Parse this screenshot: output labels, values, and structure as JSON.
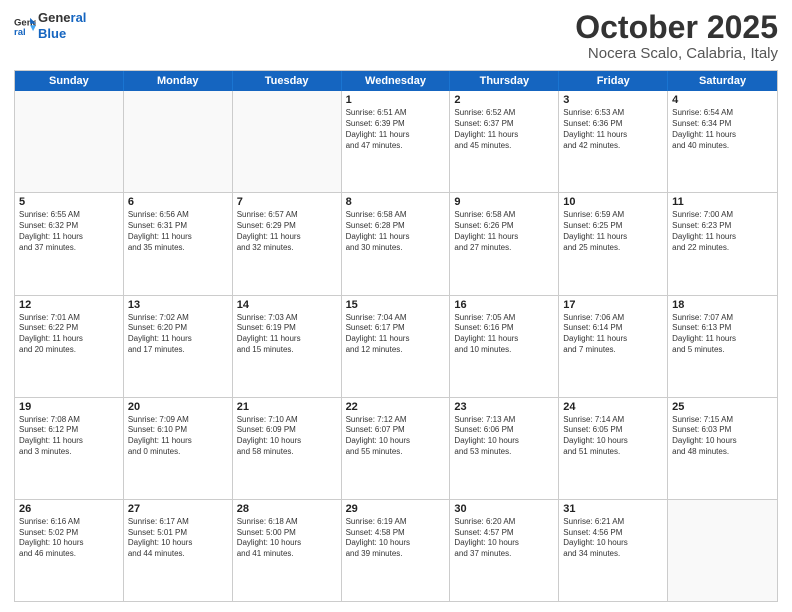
{
  "header": {
    "logo_line1": "General",
    "logo_line2": "Blue",
    "month": "October 2025",
    "location": "Nocera Scalo, Calabria, Italy"
  },
  "weekdays": [
    "Sunday",
    "Monday",
    "Tuesday",
    "Wednesday",
    "Thursday",
    "Friday",
    "Saturday"
  ],
  "weeks": [
    [
      {
        "day": "",
        "text": ""
      },
      {
        "day": "",
        "text": ""
      },
      {
        "day": "",
        "text": ""
      },
      {
        "day": "1",
        "text": "Sunrise: 6:51 AM\nSunset: 6:39 PM\nDaylight: 11 hours\nand 47 minutes."
      },
      {
        "day": "2",
        "text": "Sunrise: 6:52 AM\nSunset: 6:37 PM\nDaylight: 11 hours\nand 45 minutes."
      },
      {
        "day": "3",
        "text": "Sunrise: 6:53 AM\nSunset: 6:36 PM\nDaylight: 11 hours\nand 42 minutes."
      },
      {
        "day": "4",
        "text": "Sunrise: 6:54 AM\nSunset: 6:34 PM\nDaylight: 11 hours\nand 40 minutes."
      }
    ],
    [
      {
        "day": "5",
        "text": "Sunrise: 6:55 AM\nSunset: 6:32 PM\nDaylight: 11 hours\nand 37 minutes."
      },
      {
        "day": "6",
        "text": "Sunrise: 6:56 AM\nSunset: 6:31 PM\nDaylight: 11 hours\nand 35 minutes."
      },
      {
        "day": "7",
        "text": "Sunrise: 6:57 AM\nSunset: 6:29 PM\nDaylight: 11 hours\nand 32 minutes."
      },
      {
        "day": "8",
        "text": "Sunrise: 6:58 AM\nSunset: 6:28 PM\nDaylight: 11 hours\nand 30 minutes."
      },
      {
        "day": "9",
        "text": "Sunrise: 6:58 AM\nSunset: 6:26 PM\nDaylight: 11 hours\nand 27 minutes."
      },
      {
        "day": "10",
        "text": "Sunrise: 6:59 AM\nSunset: 6:25 PM\nDaylight: 11 hours\nand 25 minutes."
      },
      {
        "day": "11",
        "text": "Sunrise: 7:00 AM\nSunset: 6:23 PM\nDaylight: 11 hours\nand 22 minutes."
      }
    ],
    [
      {
        "day": "12",
        "text": "Sunrise: 7:01 AM\nSunset: 6:22 PM\nDaylight: 11 hours\nand 20 minutes."
      },
      {
        "day": "13",
        "text": "Sunrise: 7:02 AM\nSunset: 6:20 PM\nDaylight: 11 hours\nand 17 minutes."
      },
      {
        "day": "14",
        "text": "Sunrise: 7:03 AM\nSunset: 6:19 PM\nDaylight: 11 hours\nand 15 minutes."
      },
      {
        "day": "15",
        "text": "Sunrise: 7:04 AM\nSunset: 6:17 PM\nDaylight: 11 hours\nand 12 minutes."
      },
      {
        "day": "16",
        "text": "Sunrise: 7:05 AM\nSunset: 6:16 PM\nDaylight: 11 hours\nand 10 minutes."
      },
      {
        "day": "17",
        "text": "Sunrise: 7:06 AM\nSunset: 6:14 PM\nDaylight: 11 hours\nand 7 minutes."
      },
      {
        "day": "18",
        "text": "Sunrise: 7:07 AM\nSunset: 6:13 PM\nDaylight: 11 hours\nand 5 minutes."
      }
    ],
    [
      {
        "day": "19",
        "text": "Sunrise: 7:08 AM\nSunset: 6:12 PM\nDaylight: 11 hours\nand 3 minutes."
      },
      {
        "day": "20",
        "text": "Sunrise: 7:09 AM\nSunset: 6:10 PM\nDaylight: 11 hours\nand 0 minutes."
      },
      {
        "day": "21",
        "text": "Sunrise: 7:10 AM\nSunset: 6:09 PM\nDaylight: 10 hours\nand 58 minutes."
      },
      {
        "day": "22",
        "text": "Sunrise: 7:12 AM\nSunset: 6:07 PM\nDaylight: 10 hours\nand 55 minutes."
      },
      {
        "day": "23",
        "text": "Sunrise: 7:13 AM\nSunset: 6:06 PM\nDaylight: 10 hours\nand 53 minutes."
      },
      {
        "day": "24",
        "text": "Sunrise: 7:14 AM\nSunset: 6:05 PM\nDaylight: 10 hours\nand 51 minutes."
      },
      {
        "day": "25",
        "text": "Sunrise: 7:15 AM\nSunset: 6:03 PM\nDaylight: 10 hours\nand 48 minutes."
      }
    ],
    [
      {
        "day": "26",
        "text": "Sunrise: 6:16 AM\nSunset: 5:02 PM\nDaylight: 10 hours\nand 46 minutes."
      },
      {
        "day": "27",
        "text": "Sunrise: 6:17 AM\nSunset: 5:01 PM\nDaylight: 10 hours\nand 44 minutes."
      },
      {
        "day": "28",
        "text": "Sunrise: 6:18 AM\nSunset: 5:00 PM\nDaylight: 10 hours\nand 41 minutes."
      },
      {
        "day": "29",
        "text": "Sunrise: 6:19 AM\nSunset: 4:58 PM\nDaylight: 10 hours\nand 39 minutes."
      },
      {
        "day": "30",
        "text": "Sunrise: 6:20 AM\nSunset: 4:57 PM\nDaylight: 10 hours\nand 37 minutes."
      },
      {
        "day": "31",
        "text": "Sunrise: 6:21 AM\nSunset: 4:56 PM\nDaylight: 10 hours\nand 34 minutes."
      },
      {
        "day": "",
        "text": ""
      }
    ]
  ]
}
